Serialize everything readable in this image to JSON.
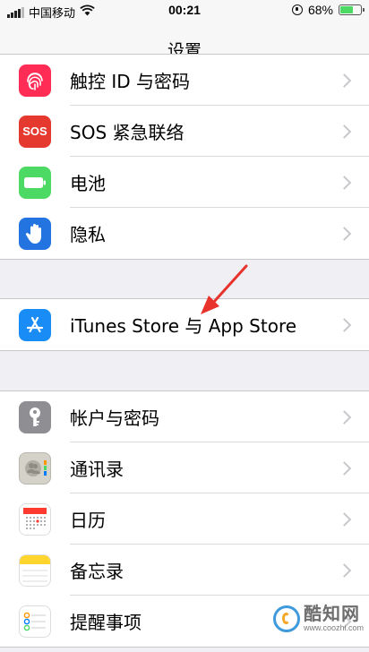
{
  "status_bar": {
    "carrier": "中国移动",
    "time": "00:21",
    "battery": "68%",
    "battery_level": 0.68,
    "icons": [
      "signal-icon",
      "wifi-icon",
      "rotation-lock-icon",
      "battery-icon"
    ]
  },
  "nav": {
    "title": "设置"
  },
  "groups": [
    {
      "items": [
        {
          "label": "触控 ID 与密码",
          "icon": "fingerprint-icon",
          "color": "#ff2d55"
        },
        {
          "label": "SOS 紧急联络",
          "icon": "sos-icon",
          "icon_text": "SOS",
          "color": "#e5382e"
        },
        {
          "label": "电池",
          "icon": "battery-icon",
          "color": "#4cd964"
        },
        {
          "label": "隐私",
          "icon": "hand-icon",
          "color": "#2374e1"
        }
      ]
    },
    {
      "items": [
        {
          "label": "iTunes Store 与 App Store",
          "icon": "app-store-icon",
          "color": "#1a8cf5"
        }
      ]
    },
    {
      "items": [
        {
          "label": "帐户与密码",
          "icon": "key-icon",
          "color": "#8e8e93"
        },
        {
          "label": "通讯录",
          "icon": "contacts-icon",
          "color": "#c9c6bd"
        },
        {
          "label": "日历",
          "icon": "calendar-icon",
          "color": "#ffffff"
        },
        {
          "label": "备忘录",
          "icon": "notes-icon",
          "color": "#ffd52e"
        },
        {
          "label": "提醒事项",
          "icon": "reminders-icon",
          "color": "#ffffff"
        }
      ]
    }
  ],
  "annotation": {
    "color": "#e8322c"
  },
  "watermark": {
    "name": "酷知网",
    "url": "www.coozhi.com"
  }
}
